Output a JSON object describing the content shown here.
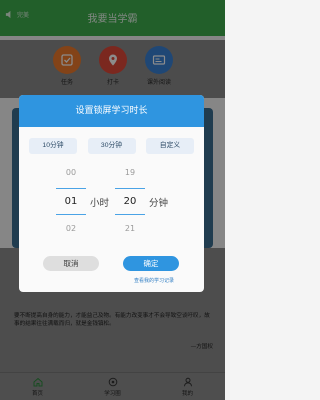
{
  "header": {
    "back_label": "完美",
    "title": "我要当学霸"
  },
  "quick": [
    {
      "label": "任务",
      "icon": "task-icon",
      "color": "#ee7b2c"
    },
    {
      "label": "打卡",
      "icon": "location-pin-icon",
      "color": "#e14a3a"
    },
    {
      "label": "课外阅读",
      "icon": "reading-card-icon",
      "color": "#3a82d6"
    }
  ],
  "quote": {
    "text": "要不断提高自身的能力，才能益己及物。有能力改变事才不会导致空谈吁叹，故事的结果往往满载而归，就是金钱镇松。",
    "author": "—方国权"
  },
  "tabs": [
    {
      "label": "首页",
      "icon": "home-icon"
    },
    {
      "label": "学习圈",
      "icon": "circle-icon"
    },
    {
      "label": "我的",
      "icon": "user-icon"
    }
  ],
  "dialog": {
    "title": "设置锁屏学习时长",
    "presets": [
      "10分钟",
      "30分钟",
      "自定义"
    ],
    "hours": {
      "above": "00",
      "selected": "01",
      "below": "02",
      "unit": "小时"
    },
    "minutes": {
      "above": "19",
      "selected": "20",
      "below": "21",
      "unit": "分钟"
    },
    "cancel_label": "取消",
    "confirm_label": "确定",
    "record_link": "查看我的学习记录"
  },
  "colors": {
    "accent": "#2f95e0",
    "header_green": "#3fae4d"
  }
}
